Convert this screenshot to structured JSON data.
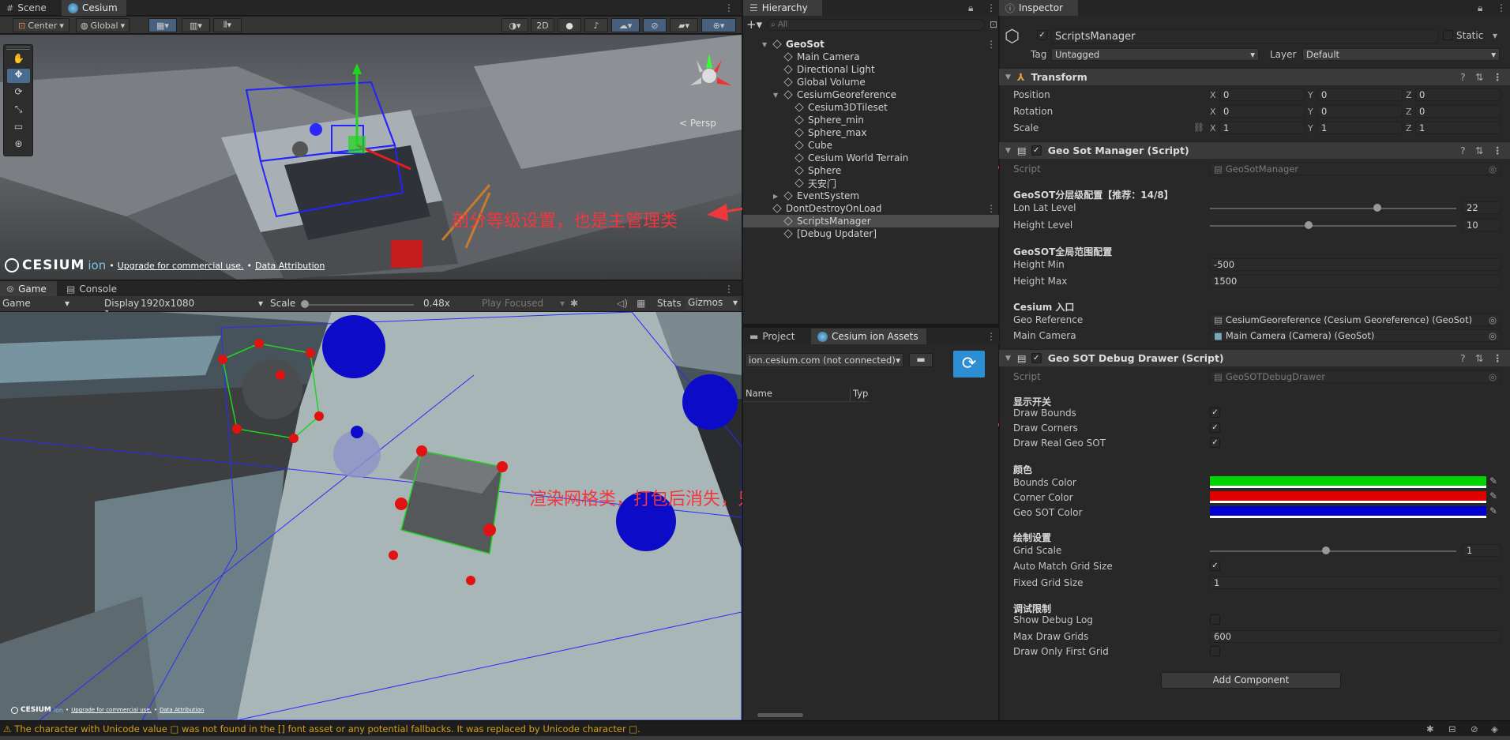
{
  "scene_tabs": {
    "scene": "Scene",
    "cesium": "Cesium"
  },
  "scene_toolbar": {
    "pivot": "Center",
    "space": "Global",
    "mode_2d": "2D",
    "persp": "< Persp"
  },
  "cesium_credit": {
    "logo": "CESIUM",
    "ion": "ion",
    "upgrade": "Upgrade for commercial use.",
    "attribution": "Data Attribution"
  },
  "game_tabs": {
    "game": "Game",
    "console": "Console"
  },
  "game_toolbar": {
    "mode": "Game",
    "display": "Display 1",
    "resolution": "1920x1080",
    "scale_label": "Scale",
    "scale_value": "0.48x",
    "play_focused": "Play Focused",
    "stats": "Stats",
    "gizmos": "Gizmos"
  },
  "game_credit": {
    "logo": "CESIUM",
    "ion": "ion",
    "upgrade": "Upgrade for commercial use.",
    "attribution": "Data Attribution"
  },
  "annotations": {
    "top": "剖分等级设置，也是主管理类",
    "bottom": "渲染网格类，打包后消失，只用于调试"
  },
  "hierarchy": {
    "title": "Hierarchy",
    "search_placeholder": "All",
    "items": [
      {
        "label": "GeoSot",
        "depth": 0,
        "bold": true
      },
      {
        "label": "Main Camera",
        "depth": 1
      },
      {
        "label": "Directional Light",
        "depth": 1
      },
      {
        "label": "Global Volume",
        "depth": 1
      },
      {
        "label": "CesiumGeoreference",
        "depth": 1
      },
      {
        "label": "Cesium3DTileset",
        "depth": 2
      },
      {
        "label": "Sphere_min",
        "depth": 2
      },
      {
        "label": "Sphere_max",
        "depth": 2
      },
      {
        "label": "Cube",
        "depth": 2
      },
      {
        "label": "Cesium World Terrain",
        "depth": 2
      },
      {
        "label": "Sphere",
        "depth": 2
      },
      {
        "label": "天安门",
        "depth": 2
      },
      {
        "label": "EventSystem",
        "depth": 1
      },
      {
        "label": "DontDestroyOnLoad",
        "depth": 0
      },
      {
        "label": "ScriptsManager",
        "depth": 1,
        "selected": true
      },
      {
        "label": "[Debug Updater]",
        "depth": 1
      }
    ]
  },
  "project": {
    "tab_project": "Project",
    "tab_ion": "Cesium ion Assets",
    "server": "ion.cesium.com (not connected)",
    "col_name": "Name",
    "col_type": "Typ"
  },
  "inspector": {
    "title": "Inspector",
    "object_name": "ScriptsManager",
    "static_label": "Static",
    "tag_label": "Tag",
    "tag_value": "Untagged",
    "layer_label": "Layer",
    "layer_value": "Default",
    "transform": {
      "title": "Transform",
      "position_label": "Position",
      "rotation_label": "Rotation",
      "scale_label": "Scale",
      "position": [
        "0",
        "0",
        "0"
      ],
      "rotation": [
        "0",
        "0",
        "0"
      ],
      "scale": [
        "1",
        "1",
        "1"
      ],
      "axes": [
        "X",
        "Y",
        "Z"
      ]
    },
    "geosot_manager": {
      "title": "Geo Sot Manager (Script)",
      "script_label": "Script",
      "script_value": "GeoSotManager",
      "sec_level": "GeoSOT分层级配置【推荐：14/8】",
      "lonlat_label": "Lon Lat Level",
      "lonlat_value": "22",
      "lonlat_frac": 0.68,
      "height_level_label": "Height Level",
      "height_level_value": "10",
      "height_level_frac": 0.4,
      "sec_range": "GeoSOT全局范围配置",
      "height_min_label": "Height Min",
      "height_min_value": "-500",
      "height_max_label": "Height Max",
      "height_max_value": "1500",
      "sec_cesium": "Cesium 入口",
      "georef_label": "Geo Reference",
      "georef_value": "CesiumGeoreference (Cesium Georeference) (GeoSot)",
      "maincam_label": "Main Camera",
      "maincam_value": "Main Camera (Camera) (GeoSot)"
    },
    "debug_drawer": {
      "title": "Geo SOT Debug Drawer (Script)",
      "script_label": "Script",
      "script_value": "GeoSOTDebugDrawer",
      "sec_display": "显示开关",
      "draw_bounds": "Draw Bounds",
      "draw_corners": "Draw Corners",
      "draw_real": "Draw Real Geo SOT",
      "sec_color": "颜色",
      "bounds_color_label": "Bounds Color",
      "bounds_color": "#00d400",
      "corner_color_label": "Corner Color",
      "corner_color": "#e00000",
      "geosot_color_label": "Geo SOT Color",
      "geosot_color": "#0000d0",
      "sec_draw": "绘制设置",
      "grid_scale_label": "Grid Scale",
      "grid_scale_value": "1",
      "grid_scale_frac": 0.47,
      "auto_match_label": "Auto Match Grid Size",
      "fixed_grid_label": "Fixed Grid Size",
      "fixed_grid_value": "1",
      "sec_debug": "调试限制",
      "show_debug_label": "Show Debug Log",
      "max_grids_label": "Max Draw Grids",
      "max_grids_value": "600",
      "draw_first_label": "Draw Only First Grid"
    },
    "add_component": "Add Component"
  },
  "status_bar": {
    "warning": "The character with Unicode value □ was not found in the [] font asset or any potential fallbacks. It was replaced by Unicode character □."
  }
}
